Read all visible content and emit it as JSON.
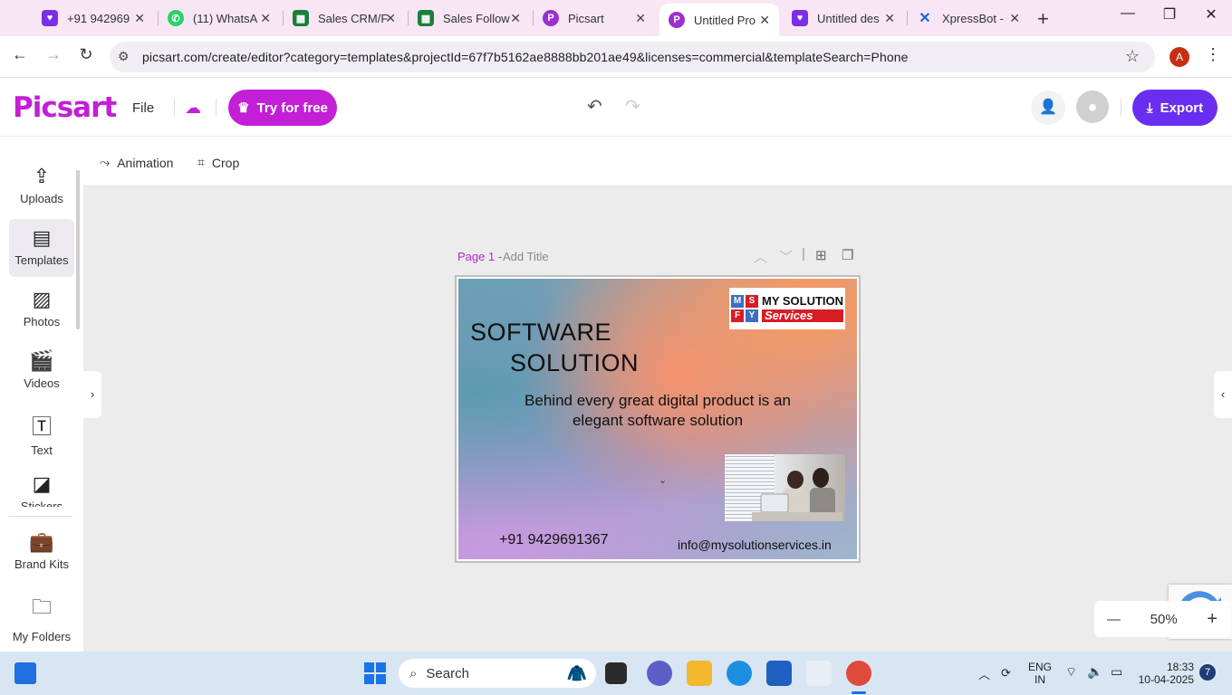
{
  "browser": {
    "tabs": [
      {
        "label": "+91 942969",
        "icon": "heart-icon",
        "color": "#7b2ee8"
      },
      {
        "label": "(11) WhatsA",
        "icon": "whatsapp-icon",
        "color": "#25d366"
      },
      {
        "label": "Sales CRM/F",
        "icon": "sheets-icon",
        "color": "#188038"
      },
      {
        "label": "Sales Follow",
        "icon": "sheets-icon",
        "color": "#188038"
      },
      {
        "label": "Picsart",
        "icon": "picsart-icon",
        "color": "#9b2fd0"
      },
      {
        "label": "Untitled Pro",
        "icon": "picsart-icon",
        "color": "#9b2fd0",
        "active": true
      },
      {
        "label": "Untitled des",
        "icon": "heart-icon",
        "color": "#7b2ee8"
      },
      {
        "label": "XpressBot -",
        "icon": "x-icon",
        "color": "#1a6ad8"
      }
    ],
    "url": "picsart.com/create/editor?category=templates&projectId=67f7b5162ae8888bb201ae49&licenses=commercial&templateSearch=Phone",
    "profile_initial": "A"
  },
  "header": {
    "logo": "Picsart",
    "file": "File",
    "try_free": "Try for free",
    "export": "Export"
  },
  "sidebar": {
    "items": [
      {
        "label": "Uploads",
        "icon": "upload-icon"
      },
      {
        "label": "Templates",
        "icon": "templates-icon",
        "active": true
      },
      {
        "label": "Photos",
        "icon": "photo-icon"
      },
      {
        "label": "Videos",
        "icon": "video-icon"
      },
      {
        "label": "Text",
        "icon": "text-icon"
      },
      {
        "label": "Stickers",
        "icon": "sticker-icon"
      },
      {
        "label": "Brand Kits",
        "icon": "brand-kit-icon"
      },
      {
        "label": "My Folders",
        "icon": "folder-icon"
      }
    ]
  },
  "toolbar": {
    "animation": "Animation",
    "crop": "Crop"
  },
  "page": {
    "label": "Page 1 -",
    "title_placeholder": "Add Title"
  },
  "design": {
    "headline_1": "SOFTWARE",
    "headline_2": "SOLUTION",
    "tagline": "Behind every great digital product is an elegant software solution",
    "phone": "+91 9429691367",
    "email": "info@mysolutionservices.in",
    "brand_grid": [
      "M",
      "S",
      "F",
      "Y"
    ],
    "brand_line_1": "MY SOLUTION",
    "brand_line_2": "Services"
  },
  "zoom": {
    "value": "50%"
  },
  "taskbar": {
    "search": "Search",
    "lang_1": "ENG",
    "lang_2": "IN",
    "time": "18:33",
    "date": "10-04-2025",
    "notifications": "7"
  }
}
